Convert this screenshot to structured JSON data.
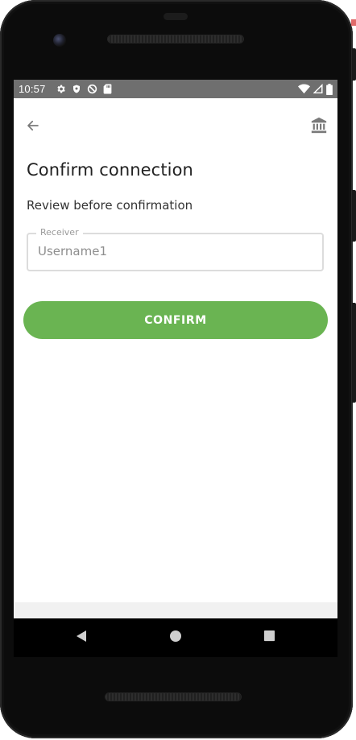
{
  "status_bar": {
    "time": "10:57",
    "left_icons": [
      "settings-icon",
      "shield-icon",
      "blocked-icon",
      "sd-card-icon"
    ],
    "right_icons": [
      "wifi-icon",
      "cell-signal-icon",
      "battery-icon"
    ]
  },
  "app_bar": {
    "back_icon": "arrow-left-icon",
    "bank_icon": "bank-icon"
  },
  "content": {
    "title": "Confirm connection",
    "subtitle": "Review before confirmation",
    "receiver_field": {
      "label": "Receiver",
      "value": "Username1"
    },
    "confirm_label": "CONFIRM"
  },
  "nav_bar": {
    "icons": [
      "nav-back-icon",
      "nav-home-icon",
      "nav-recents-icon"
    ]
  },
  "colors": {
    "accent": "#6ab452",
    "status_bar": "#6f6f6f",
    "icon_gray": "#7a7a7a"
  }
}
